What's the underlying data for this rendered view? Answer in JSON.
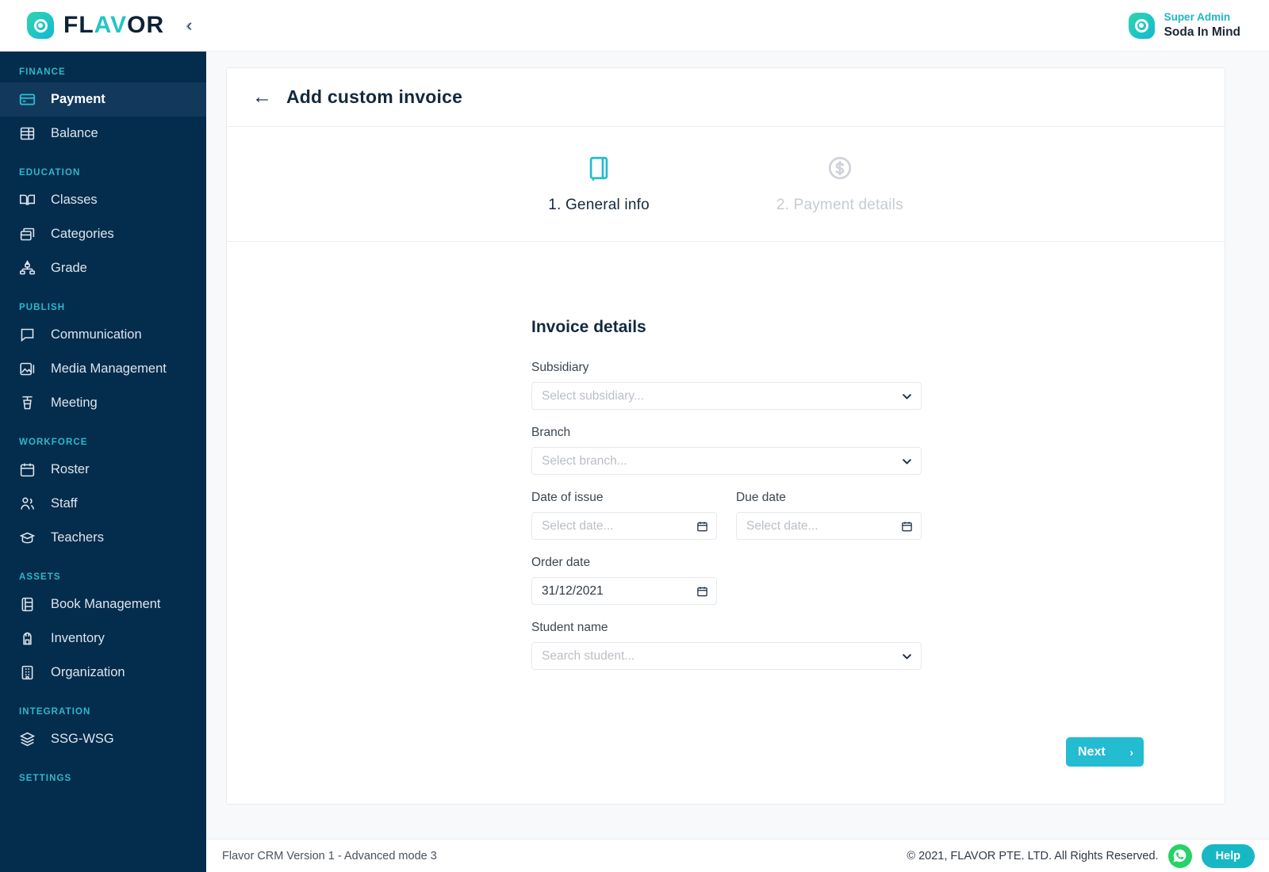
{
  "brand": {
    "name_dark_1": "FL",
    "name_accent": "AV",
    "name_dark_2": "OR",
    "collapse_icon": "double-chevron-left"
  },
  "user": {
    "role": "Super Admin",
    "name": "Soda In Mind"
  },
  "sidebar": {
    "sections": [
      {
        "label": "FINANCE",
        "items": [
          {
            "label": "Payment",
            "icon": "credit-card-icon",
            "active": true
          },
          {
            "label": "Balance",
            "icon": "stacked-bars-icon",
            "active": false
          }
        ]
      },
      {
        "label": "EDUCATION",
        "items": [
          {
            "label": "Classes",
            "icon": "open-book-icon",
            "active": false
          },
          {
            "label": "Categories",
            "icon": "boxes-icon",
            "active": false
          },
          {
            "label": "Grade",
            "icon": "hierarchy-icon",
            "active": false
          }
        ]
      },
      {
        "label": "PUBLISH",
        "items": [
          {
            "label": "Communication",
            "icon": "chat-bubble-icon",
            "active": false
          },
          {
            "label": "Media Management",
            "icon": "image-icon",
            "active": false
          },
          {
            "label": "Meeting",
            "icon": "podium-icon",
            "active": false
          }
        ]
      },
      {
        "label": "WORKFORCE",
        "items": [
          {
            "label": "Roster",
            "icon": "calendar-icon",
            "active": false
          },
          {
            "label": "Staff",
            "icon": "people-icon",
            "active": false
          },
          {
            "label": "Teachers",
            "icon": "graduation-cap-icon",
            "active": false
          }
        ]
      },
      {
        "label": "ASSETS",
        "items": [
          {
            "label": "Book Management",
            "icon": "book-icon",
            "active": false
          },
          {
            "label": "Inventory",
            "icon": "backpack-icon",
            "active": false
          },
          {
            "label": "Organization",
            "icon": "building-icon",
            "active": false
          }
        ]
      },
      {
        "label": "INTEGRATION",
        "items": [
          {
            "label": "SSG-WSG",
            "icon": "layers-icon",
            "active": false
          }
        ]
      },
      {
        "label": "SETTINGS",
        "items": []
      }
    ]
  },
  "page": {
    "title": "Add custom invoice",
    "back_icon": "arrow-left-icon",
    "steps": [
      {
        "label": "1. General info",
        "icon": "book-icon",
        "state": "active"
      },
      {
        "label": "2. Payment details",
        "icon": "dollar-coin-icon",
        "state": "inactive"
      }
    ],
    "form": {
      "title": "Invoice details",
      "fields": {
        "subsidiary": {
          "label": "Subsidiary",
          "placeholder": "Select subsidiary...",
          "value": "",
          "icon": "chevron-down-icon"
        },
        "branch": {
          "label": "Branch",
          "placeholder": "Select branch...",
          "value": "",
          "icon": "chevron-down-icon"
        },
        "date_of_issue": {
          "label": "Date of issue",
          "placeholder": "Select date...",
          "value": "",
          "icon": "calendar-icon"
        },
        "due_date": {
          "label": "Due date",
          "placeholder": "Select date...",
          "value": "",
          "icon": "calendar-icon"
        },
        "order_date": {
          "label": "Order date",
          "placeholder": "Select date...",
          "value": "31/12/2021",
          "icon": "calendar-icon"
        },
        "student_name": {
          "label": "Student name",
          "placeholder": "Search student...",
          "value": "",
          "icon": "chevron-down-icon"
        }
      }
    },
    "next_button": {
      "label": "Next",
      "arrow": "›"
    }
  },
  "footer": {
    "version": "Flavor CRM Version 1 - Advanced mode 3",
    "copyright": "© 2021, FLAVOR PTE. LTD. All Rights Reserved.",
    "whatsapp_icon": "whatsapp-icon",
    "help_label": "Help"
  },
  "colors": {
    "sidebar_bg": "#042c4d",
    "sidebar_active": "#12395c",
    "accent_teal": "#24bcd0",
    "section_label": "#2eb8c9",
    "title_navy": "#12293f",
    "whatsapp_green": "#25d366"
  }
}
